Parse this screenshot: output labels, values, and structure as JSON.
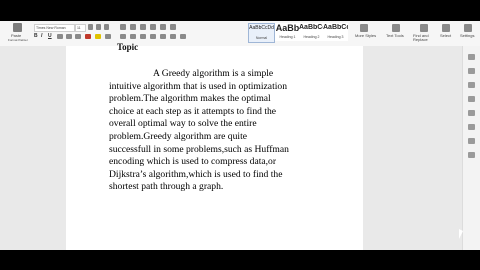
{
  "ribbon": {
    "paste_label": "Paste",
    "clipboard_label": "Format Painter",
    "font_name": "Times New Roman",
    "font_size": "11",
    "bold": "B",
    "italic": "I",
    "underline": "U",
    "styles": [
      {
        "preview": "AaBbCcDd",
        "label": "Normal"
      },
      {
        "preview": "AaBb",
        "label": "Heading 1"
      },
      {
        "preview": "AaBbCc",
        "label": "Heading 2"
      },
      {
        "preview": "AaBbCc",
        "label": "Heading 3"
      }
    ],
    "more_styles_label": "More Styles",
    "text_tools_label": "Text Tools",
    "find_replace_label": "Find and Replace",
    "select_label": "Select",
    "settings_label": "Settings"
  },
  "document": {
    "heading_fragment": "Topic",
    "lines": [
      "A Greedy algorithm is a simple",
      "intuitive algorithm that is used in optimization",
      "problem.The algorithm makes the optimal",
      "choice at each step as it attempts to find the",
      "overall optimal way to solve the entire",
      "problem.Greedy algorithm are quite",
      "successfull in some problems,such as Huffman",
      "encoding which is used to compress data,or",
      "Dijkstra’s algorithm,which is used to find the",
      "shortest path through a graph."
    ]
  }
}
